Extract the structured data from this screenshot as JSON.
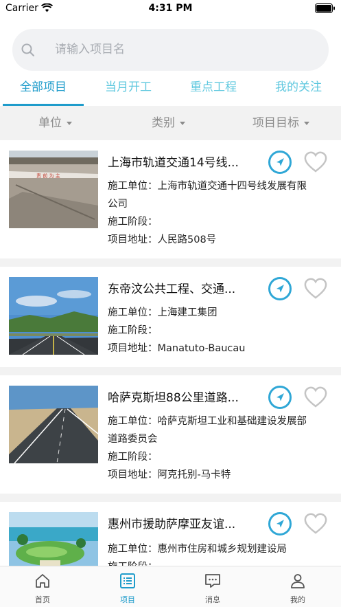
{
  "status_bar": {
    "carrier": "Carrier",
    "time": "4:31 PM"
  },
  "search": {
    "placeholder": "请输入项目名"
  },
  "tabs": [
    {
      "label": "全部项目",
      "active": true
    },
    {
      "label": "当月开工",
      "active": false
    },
    {
      "label": "重点工程",
      "active": false
    },
    {
      "label": "我的关注",
      "active": false
    }
  ],
  "filters": [
    {
      "label": "单位"
    },
    {
      "label": "类别"
    },
    {
      "label": "项目目标"
    }
  ],
  "projects": [
    {
      "title": "上海市轨道交通14号线...",
      "unit_line1": "施工单位：上海市轨道交通十四号线发展有限",
      "unit_line2": "公司",
      "stage": "施工阶段：",
      "address": "项目地址：人民路508号"
    },
    {
      "title": "东帝汶公共工程、交通...",
      "unit_line1": "施工单位：上海建工集团",
      "unit_line2": "",
      "stage": "施工阶段：",
      "address": "项目地址：Manatuto-Baucau"
    },
    {
      "title": "哈萨克斯坦88公里道路...",
      "unit_line1": "施工单位：哈萨克斯坦工业和基础建设发展部",
      "unit_line2": "道路委员会",
      "stage": "施工阶段：",
      "address": "项目地址：阿克托别-马卡特"
    },
    {
      "title": "惠州市援助萨摩亚友谊...",
      "unit_line1": "施工单位：惠州市住房和城乡规划建设局",
      "unit_line2": "",
      "stage": "施工阶段：",
      "address": ""
    }
  ],
  "tabbar": [
    {
      "label": "首页",
      "icon": "home-icon",
      "active": false
    },
    {
      "label": "项目",
      "icon": "list-icon",
      "active": true
    },
    {
      "label": "消息",
      "icon": "message-icon",
      "active": false
    },
    {
      "label": "我的",
      "icon": "user-icon",
      "active": false
    }
  ],
  "colors": {
    "accent": "#1f9ccb",
    "tab_inactive": "#5fc8df",
    "separator": "#f2f2f2"
  }
}
